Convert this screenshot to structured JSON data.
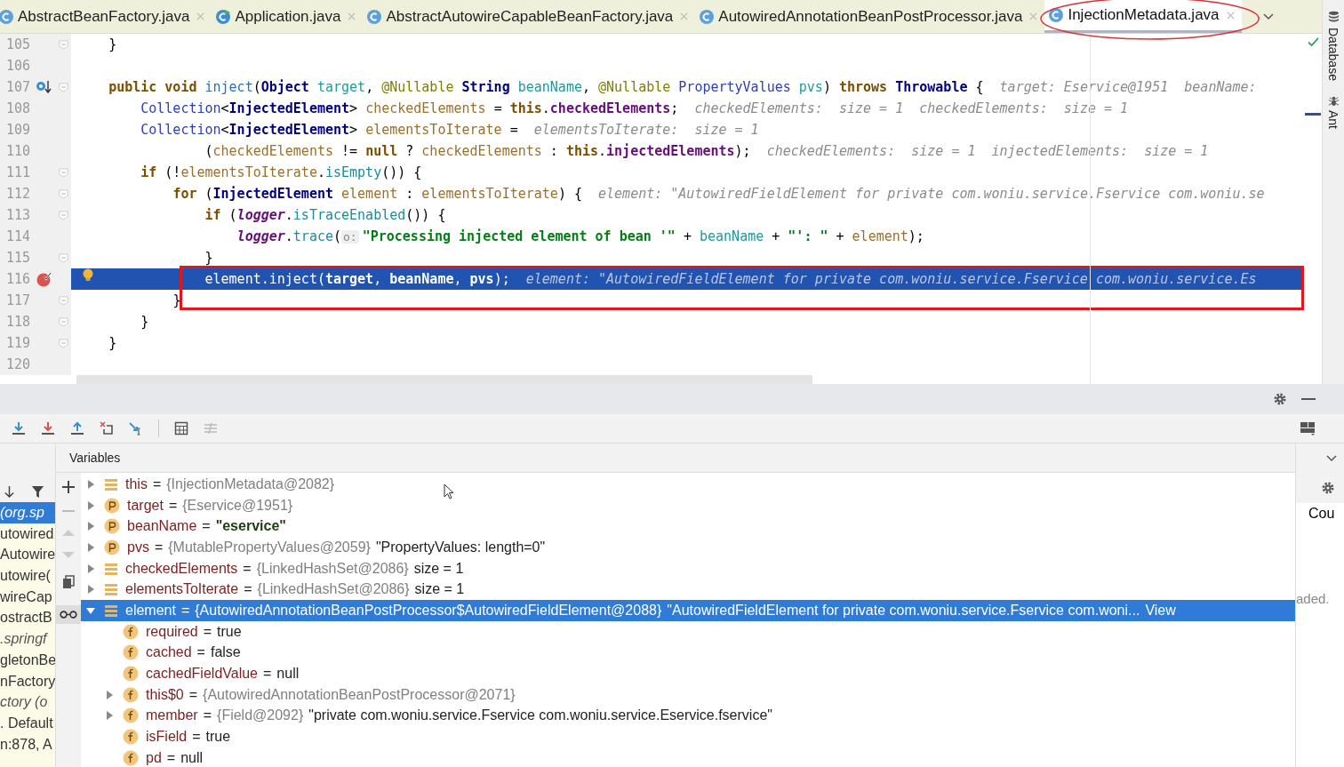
{
  "tabs": [
    {
      "label": "AbstractBeanFactory.java",
      "kind": "class",
      "selected": false
    },
    {
      "label": "Application.java",
      "kind": "app",
      "selected": false
    },
    {
      "label": "AbstractAutowireCapableBeanFactory.java",
      "kind": "class",
      "selected": false
    },
    {
      "label": "AutowiredAnnotationBeanPostProcessor.java",
      "kind": "class",
      "selected": false
    },
    {
      "label": "InjectionMetadata.java",
      "kind": "class",
      "selected": true,
      "circled": true
    }
  ],
  "side_tools": [
    "Database",
    "Ant"
  ],
  "editor": {
    "lines": [
      {
        "number": "105",
        "fold": true,
        "tokens": [
          {
            "kind": "plain",
            "text": "    }"
          }
        ]
      },
      {
        "number": "106"
      },
      {
        "number": "107",
        "fold": true,
        "overrides": true,
        "tokens": [
          {
            "kind": "kw",
            "text": "    public void "
          },
          {
            "kind": "decl",
            "text": "inject"
          },
          {
            "kind": "plain",
            "text": "("
          },
          {
            "kind": "type",
            "text": "Object "
          },
          {
            "kind": "param",
            "text": "target"
          },
          {
            "kind": "plain",
            "text": ", "
          },
          {
            "kind": "ann",
            "text": "@Nullable "
          },
          {
            "kind": "type",
            "text": "String "
          },
          {
            "kind": "param",
            "text": "beanName"
          },
          {
            "kind": "plain",
            "text": ", "
          },
          {
            "kind": "ann",
            "text": "@Nullable "
          },
          {
            "kind": "cls",
            "text": "PropertyValues "
          },
          {
            "kind": "param",
            "text": "pvs"
          },
          {
            "kind": "plain",
            "text": ") "
          },
          {
            "kind": "kw",
            "text": "throws "
          },
          {
            "kind": "type",
            "text": "Throwable"
          },
          {
            "kind": "plain",
            "text": " {"
          },
          {
            "kind": "hint",
            "text": "  target: Eservice@1951  beanName:"
          }
        ]
      },
      {
        "number": "108",
        "tokens": [
          {
            "kind": "cls",
            "text": "        Collection"
          },
          {
            "kind": "plain",
            "text": "<"
          },
          {
            "kind": "type",
            "text": "InjectedElement"
          },
          {
            "kind": "plain",
            "text": "> "
          },
          {
            "kind": "local",
            "text": "checkedElements"
          },
          {
            "kind": "plain",
            "text": " = "
          },
          {
            "kind": "kw",
            "text": "this"
          },
          {
            "kind": "plain",
            "text": "."
          },
          {
            "kind": "field",
            "text": "checkedElements"
          },
          {
            "kind": "plain",
            "text": ";"
          },
          {
            "kind": "hint",
            "text": "  checkedElements:  size = 1  checkedElements:  size = 1"
          }
        ]
      },
      {
        "number": "109",
        "tokens": [
          {
            "kind": "cls",
            "text": "        Collection"
          },
          {
            "kind": "plain",
            "text": "<"
          },
          {
            "kind": "type",
            "text": "InjectedElement"
          },
          {
            "kind": "plain",
            "text": "> "
          },
          {
            "kind": "local",
            "text": "elementsToIterate"
          },
          {
            "kind": "plain",
            "text": " = "
          },
          {
            "kind": "hint",
            "text": " elementsToIterate:  size = 1"
          }
        ]
      },
      {
        "number": "110",
        "tokens": [
          {
            "kind": "plain",
            "text": "                ("
          },
          {
            "kind": "local",
            "text": "checkedElements"
          },
          {
            "kind": "plain",
            "text": " != "
          },
          {
            "kind": "kw",
            "text": "null"
          },
          {
            "kind": "plain",
            "text": " ? "
          },
          {
            "kind": "local",
            "text": "checkedElements"
          },
          {
            "kind": "plain",
            "text": " : "
          },
          {
            "kind": "kw",
            "text": "this"
          },
          {
            "kind": "plain",
            "text": "."
          },
          {
            "kind": "field",
            "text": "injectedElements"
          },
          {
            "kind": "plain",
            "text": ");"
          },
          {
            "kind": "hint",
            "text": "  checkedElements:  size = 1  injectedElements:  size = 1"
          }
        ]
      },
      {
        "number": "111",
        "fold": true,
        "tokens": [
          {
            "kind": "kw",
            "text": "        if"
          },
          {
            "kind": "plain",
            "text": " (!"
          },
          {
            "kind": "local",
            "text": "elementsToIterate"
          },
          {
            "kind": "plain",
            "text": "."
          },
          {
            "kind": "call",
            "text": "isEmpty"
          },
          {
            "kind": "plain",
            "text": "()) {"
          }
        ]
      },
      {
        "number": "112",
        "fold": true,
        "tokens": [
          {
            "kind": "kw",
            "text": "            for"
          },
          {
            "kind": "plain",
            "text": " ("
          },
          {
            "kind": "type",
            "text": "InjectedElement "
          },
          {
            "kind": "local",
            "text": "element"
          },
          {
            "kind": "plain",
            "text": " : "
          },
          {
            "kind": "local",
            "text": "elementsToIterate"
          },
          {
            "kind": "plain",
            "text": ") {"
          },
          {
            "kind": "hint",
            "text": "  element: \"AutowiredFieldElement for private com.woniu.service.Fservice com.woniu.se"
          }
        ]
      },
      {
        "number": "113",
        "fold": true,
        "tokens": [
          {
            "kind": "kw",
            "text": "                if"
          },
          {
            "kind": "plain",
            "text": " ("
          },
          {
            "kind": "static",
            "text": "logger"
          },
          {
            "kind": "plain",
            "text": "."
          },
          {
            "kind": "call",
            "text": "isTraceEnabled"
          },
          {
            "kind": "plain",
            "text": "()) {"
          }
        ]
      },
      {
        "number": "114",
        "tokens": [
          {
            "kind": "static",
            "text": "                    logger"
          },
          {
            "kind": "plain",
            "text": "."
          },
          {
            "kind": "call",
            "text": "trace"
          },
          {
            "kind": "plain",
            "text": "("
          },
          {
            "kind": "inlay",
            "text": "o:"
          },
          {
            "kind": "str",
            "text": "\"Processing injected element of bean '\""
          },
          {
            "kind": "plain",
            "text": " + "
          },
          {
            "kind": "param",
            "text": "beanName"
          },
          {
            "kind": "plain",
            "text": " + "
          },
          {
            "kind": "str",
            "text": "\"': \""
          },
          {
            "kind": "plain",
            "text": " + "
          },
          {
            "kind": "local",
            "text": "element"
          },
          {
            "kind": "plain",
            "text": ");"
          }
        ]
      },
      {
        "number": "115",
        "fold": true,
        "tokens": [
          {
            "kind": "plain",
            "text": "                }"
          }
        ]
      },
      {
        "number": "116",
        "breakpoint": true,
        "bulb": true,
        "current": true,
        "boxed": true,
        "tokens": [
          {
            "kind": "plain",
            "text": "                element.inject("
          },
          {
            "kind": "bold",
            "text": "target"
          },
          {
            "kind": "plain",
            "text": ", "
          },
          {
            "kind": "bold",
            "text": "beanName"
          },
          {
            "kind": "plain",
            "text": ", "
          },
          {
            "kind": "bold",
            "text": "pvs"
          },
          {
            "kind": "plain",
            "text": ");"
          },
          {
            "kind": "hint",
            "text": "  element: \"AutowiredFieldElement for private com.woniu.service.Fservice com.woniu.service.Es"
          }
        ]
      },
      {
        "number": "117",
        "fold": true,
        "tokens": [
          {
            "kind": "plain",
            "text": "            }"
          }
        ]
      },
      {
        "number": "118",
        "fold": true,
        "tokens": [
          {
            "kind": "plain",
            "text": "        }"
          }
        ]
      },
      {
        "number": "119",
        "fold": true,
        "tokens": [
          {
            "kind": "plain",
            "text": "    }"
          }
        ]
      },
      {
        "number": "120"
      }
    ]
  },
  "debugger": {
    "frames": [
      {
        "text": "(org.sp",
        "kind": "library",
        "selected": true
      },
      {
        "text": "utowired",
        "kind": "app",
        "selected": false
      },
      {
        "text": "Autowire",
        "kind": "app",
        "selected": false
      },
      {
        "text": "utowire(",
        "kind": "app",
        "selected": false
      },
      {
        "text": "wireCap",
        "kind": "app",
        "selected": false
      },
      {
        "text": "ostractB",
        "kind": "app",
        "selected": false
      },
      {
        "text": ".springf",
        "kind": "library",
        "selected": false
      },
      {
        "text": "gletonBe",
        "kind": "app",
        "selected": false
      },
      {
        "text": "nFactory",
        "kind": "app",
        "selected": false
      },
      {
        "text": "ctory (o",
        "kind": "library",
        "selected": false
      },
      {
        "text": ". Default",
        "kind": "app",
        "selected": false
      },
      {
        "text": "n:878, A",
        "kind": "app",
        "selected": false
      }
    ],
    "variables_title": "Variables",
    "variables": [
      {
        "kind": "local",
        "name": "this",
        "operator": "=",
        "value": {
          "kind": "ref",
          "text": "{InjectionMetadata@2082}"
        },
        "expandable": true,
        "expanded": false,
        "selected": false
      },
      {
        "kind": "param",
        "name": "target",
        "operator": "=",
        "value": {
          "kind": "ref",
          "text": "{Eservice@1951}"
        },
        "expandable": true,
        "expanded": false,
        "selected": false
      },
      {
        "kind": "param",
        "name": "beanName",
        "operator": "=",
        "value": {
          "kind": "string",
          "text": "\"eservice\""
        },
        "expandable": true,
        "expanded": false,
        "selected": false
      },
      {
        "kind": "param",
        "name": "pvs",
        "operator": "=",
        "value": {
          "kind": "ref",
          "text": "{MutablePropertyValues@2059}"
        },
        "detail": "\"PropertyValues: length=0\"",
        "expandable": true,
        "expanded": false,
        "selected": false
      },
      {
        "kind": "local",
        "name": "checkedElements",
        "operator": "=",
        "value": {
          "kind": "ref",
          "text": "{LinkedHashSet@2086}"
        },
        "detail": "size = 1",
        "expandable": true,
        "expanded": false,
        "selected": false
      },
      {
        "kind": "local",
        "name": "elementsToIterate",
        "operator": "=",
        "value": {
          "kind": "ref",
          "text": "{LinkedHashSet@2086}"
        },
        "detail": "size = 1",
        "expandable": true,
        "expanded": false,
        "selected": false
      },
      {
        "kind": "local",
        "name": "element",
        "operator": "=",
        "value": {
          "kind": "ref",
          "text": "{AutowiredAnnotationBeanPostProcessor$AutowiredFieldElement@2088}"
        },
        "detail": "\"AutowiredFieldElement for private com.woniu.service.Fservice com.woni...",
        "link": "View",
        "expandable": true,
        "expanded": true,
        "selected": true,
        "children": [
          {
            "kind": "field",
            "name": "required",
            "operator": "=",
            "value": {
              "kind": "literal",
              "text": "true"
            },
            "selected": false
          },
          {
            "kind": "field",
            "name": "cached",
            "operator": "=",
            "value": {
              "kind": "literal",
              "text": "false"
            },
            "selected": false
          },
          {
            "kind": "field",
            "name": "cachedFieldValue",
            "operator": "=",
            "value": {
              "kind": "literal",
              "text": "null"
            },
            "selected": false
          },
          {
            "kind": "field",
            "name": "this$0",
            "operator": "=",
            "value": {
              "kind": "ref",
              "text": "{AutowiredAnnotationBeanPostProcessor@2071}"
            },
            "expandable": true,
            "expanded": false,
            "selected": false
          },
          {
            "kind": "field",
            "name": "member",
            "operator": "=",
            "value": {
              "kind": "ref",
              "text": "{Field@2092}"
            },
            "detail": "\"private com.woniu.service.Fservice com.woniu.service.Eservice.fservice\"",
            "expandable": true,
            "expanded": false,
            "selected": false
          },
          {
            "kind": "field",
            "name": "isField",
            "operator": "=",
            "value": {
              "kind": "literal",
              "text": "true"
            },
            "selected": false
          },
          {
            "kind": "field",
            "name": "pd",
            "operator": "=",
            "value": {
              "kind": "literal",
              "text": "null"
            },
            "selected": false
          }
        ]
      }
    ],
    "side_panel": {
      "header": "Cou",
      "message": "aded."
    }
  }
}
